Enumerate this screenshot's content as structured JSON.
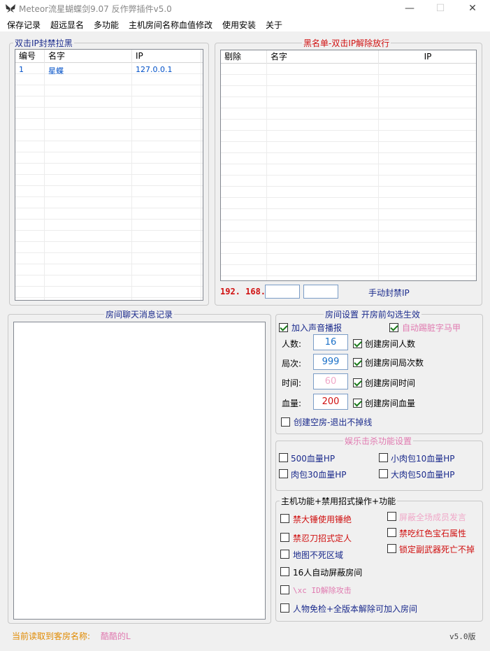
{
  "window": {
    "title": "Meteor流星蝴蝶剑9.07 反作弊插件v5.0",
    "minimize": "—",
    "maximize": "☐",
    "close": "✕"
  },
  "menu": [
    "保存记录",
    "超远显名",
    "多功能",
    "主机房间名称血值修改",
    "使用安装",
    "关于"
  ],
  "ban_pull_group": {
    "title": "双击IP封禁拉黑",
    "columns": [
      "编号",
      "名字",
      "IP"
    ],
    "rows": [
      {
        "id": "1",
        "name": "星蝶",
        "ip": "127.0.0.1"
      }
    ]
  },
  "blacklist_group": {
    "title": "黑名单-双击IP解除放行",
    "columns": [
      "剔除",
      "名字",
      "IP"
    ],
    "ip_prefix": "192. 168.",
    "ip_part3": "",
    "ip_part4": "",
    "manual_ban_label": "手动封禁IP"
  },
  "chat_group": {
    "title": "房间聊天消息记录",
    "log": ""
  },
  "room_settings": {
    "title": "房间设置 开房前勾选生效",
    "sound_label": "加入声音播报",
    "sound_checked": true,
    "auto_kick_label": "自动踢脏字马甲",
    "auto_kick_checked": true,
    "players_label": "人数:",
    "players_value": "16",
    "players_check_label": "创建房间人数",
    "players_checked": true,
    "rounds_label": "局次:",
    "rounds_value": "999",
    "rounds_check_label": "创建房间局次数",
    "rounds_checked": true,
    "time_label": "时间:",
    "time_value": "60",
    "time_check_label": "创建房间时间",
    "time_checked": true,
    "hp_label": "血量:",
    "hp_value": "200",
    "hp_check_label": "创建房间血量",
    "hp_checked": true,
    "empty_room_label": "创建空房-退出不掉线",
    "empty_room_checked": false
  },
  "fun_settings": {
    "title": "娱乐击杀功能设置",
    "options": [
      {
        "label": "500血量HP",
        "checked": false
      },
      {
        "label": "小肉包10血量HP",
        "checked": false
      },
      {
        "label": "肉包30血量HP",
        "checked": false
      },
      {
        "label": "大肉包50血量HP",
        "checked": false
      }
    ]
  },
  "host_features": {
    "title": "主机功能+禁用招式操作+功能",
    "options": [
      {
        "label": "禁大锤使用锤绝",
        "checked": false
      },
      {
        "label": "屏蔽全场成员发言",
        "checked": false
      },
      {
        "label": "禁忍刀招式定人",
        "checked": false
      },
      {
        "label": "禁吃红色宝石属性",
        "checked": false
      },
      {
        "label": "锁定副武器死亡不掉",
        "checked": false
      },
      {
        "label": "地图不死区域",
        "checked": false
      },
      {
        "label": "16人自动屏蔽房间",
        "checked": false
      },
      {
        "label": "\\xc ID解除攻击",
        "checked": false
      },
      {
        "label": "人物免检+全版本解除可加入房间",
        "checked": false
      }
    ]
  },
  "status": {
    "current_room_label": "当前读取到客房名称:",
    "current_room_value": "酷酷的L",
    "version": "v5.0版"
  },
  "colors": {
    "orange": "#e08a00",
    "red": "#d01010",
    "blue_text": "#1a2a8c",
    "pink": "#e07ab0",
    "input_blue": "#1a70c8"
  }
}
